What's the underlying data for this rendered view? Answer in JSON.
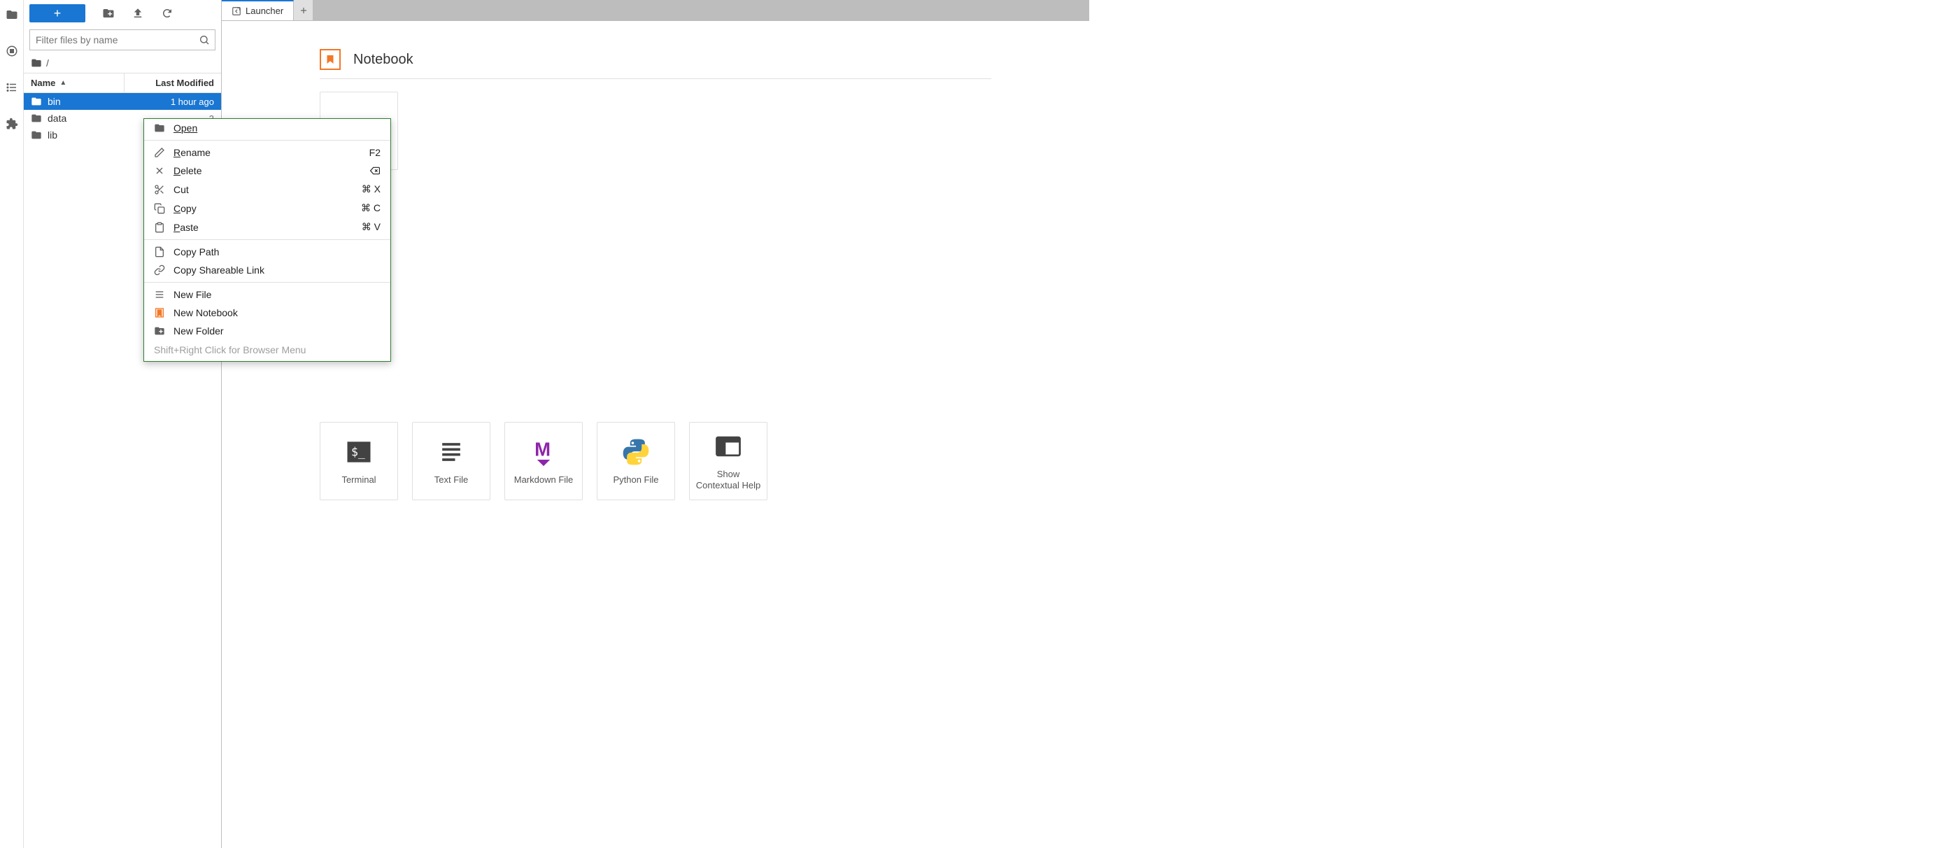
{
  "activity": {
    "items": [
      "folder",
      "stop",
      "list",
      "extension"
    ]
  },
  "filebrowser": {
    "new_label": "+",
    "filter_placeholder": "Filter files by name",
    "breadcrumb_root": "/",
    "columns": {
      "name": "Name",
      "modified": "Last Modified"
    },
    "rows": [
      {
        "name": "bin",
        "modified": "1 hour ago",
        "selected": true
      },
      {
        "name": "data",
        "modified": "3",
        "selected": false
      },
      {
        "name": "lib",
        "modified": "",
        "selected": false
      }
    ]
  },
  "tabs": {
    "active": "Launcher"
  },
  "launcher": {
    "sections": {
      "notebook": {
        "title": "Notebook"
      },
      "other_cards": [
        {
          "label": "Terminal"
        },
        {
          "label": "Text File"
        },
        {
          "label": "Markdown File"
        },
        {
          "label": "Python File"
        },
        {
          "label": "Show Contextual Help"
        }
      ]
    }
  },
  "context_menu": {
    "items": [
      {
        "icon": "folder",
        "label": "Open",
        "shortcut": "",
        "underline": 0
      },
      {
        "sep": true
      },
      {
        "icon": "pencil",
        "label": "Rename",
        "shortcut": "F2",
        "underline": 0
      },
      {
        "icon": "x",
        "label": "Delete",
        "shortcut": "⌫",
        "underline": 0
      },
      {
        "icon": "scissors",
        "label": "Cut",
        "shortcut": "⌘ X",
        "underline": -1
      },
      {
        "icon": "copy",
        "label": "Copy",
        "shortcut": "⌘ C",
        "underline": 0
      },
      {
        "icon": "clipboard",
        "label": "Paste",
        "shortcut": "⌘ V",
        "underline": 0
      },
      {
        "sep": true
      },
      {
        "icon": "file",
        "label": "Copy Path",
        "shortcut": "",
        "underline": -1
      },
      {
        "icon": "link",
        "label": "Copy Shareable Link",
        "shortcut": "",
        "underline": -1
      },
      {
        "sep": true
      },
      {
        "icon": "lines",
        "label": "New File",
        "shortcut": "",
        "underline": -1
      },
      {
        "icon": "notebook",
        "label": "New Notebook",
        "shortcut": "",
        "underline": -1
      },
      {
        "icon": "newfolder",
        "label": "New Folder",
        "shortcut": "",
        "underline": -1
      }
    ],
    "hint": "Shift+Right Click for Browser Menu"
  }
}
